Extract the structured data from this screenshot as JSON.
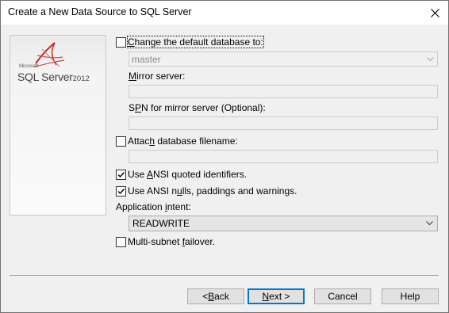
{
  "window": {
    "title": "Create a New Data Source to SQL Server"
  },
  "banner": {
    "brand_small": "Microsoft",
    "product": "SQL Server",
    "version": "2012"
  },
  "options": {
    "change_db": {
      "pre": "",
      "key": "C",
      "post": "hange the default database to:",
      "checked": false
    },
    "default_database": {
      "value": "master"
    },
    "mirror_server": {
      "pre": "",
      "key": "M",
      "post": "irror server:",
      "value": ""
    },
    "spn": {
      "pre": "S",
      "key": "P",
      "post": "N for mirror server (Optional):",
      "value": ""
    },
    "attach_db": {
      "pre": "Attac",
      "key": "h",
      "post": " database filename:",
      "checked": false,
      "value": ""
    },
    "ansi_quoted": {
      "pre": "Use ",
      "key": "A",
      "post": "NSI quoted identifiers.",
      "checked": true
    },
    "ansi_nulls": {
      "pre": "Use ANSI n",
      "key": "u",
      "post": "lls, paddings and warnings.",
      "checked": true
    },
    "app_intent": {
      "pre": "Application ",
      "key": "i",
      "post": "ntent:",
      "value": "READWRITE"
    },
    "multi_subnet": {
      "pre": "Multi-subnet ",
      "key": "f",
      "post": "ailover.",
      "checked": false
    }
  },
  "buttons": {
    "back": {
      "pre": "< ",
      "key": "B",
      "post": "ack"
    },
    "next": {
      "pre": "",
      "key": "N",
      "post": "ext >"
    },
    "cancel": {
      "label": "Cancel"
    },
    "help": {
      "label": "Help"
    }
  }
}
